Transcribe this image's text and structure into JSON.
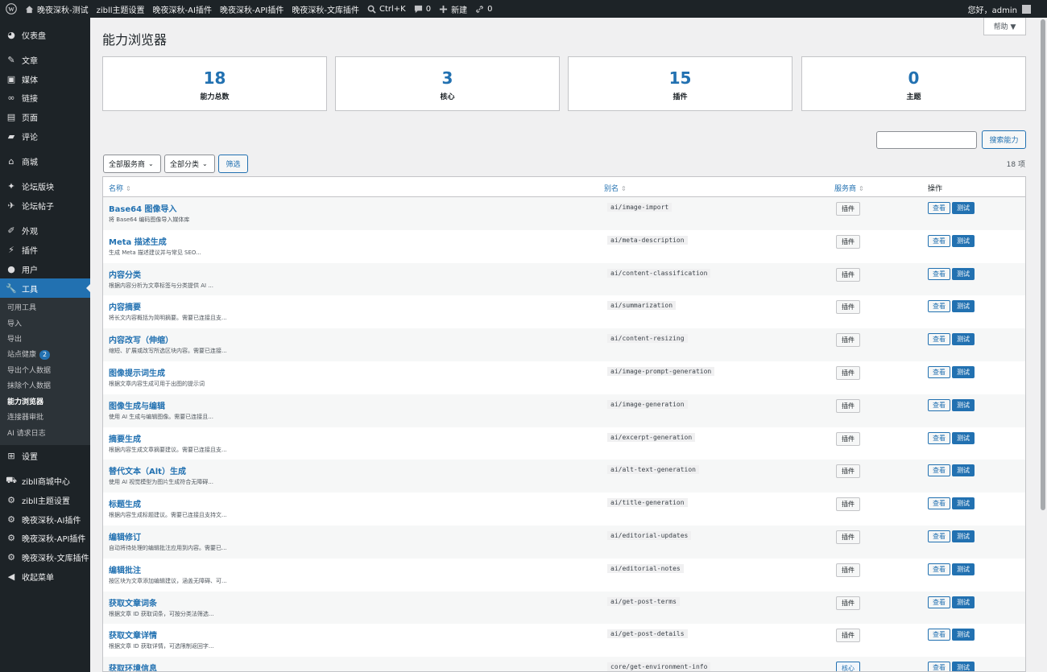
{
  "adminbar": {
    "site_name": "晚夜深秋-测试",
    "items": [
      "zibll主题设置",
      "晚夜深秋-AI插件",
      "晚夜深秋-API插件",
      "晚夜深秋-文库插件"
    ],
    "search_label": "Ctrl+K",
    "comments_count": "0",
    "new_label": "新建",
    "links_count": "0",
    "greeting": "您好，admin"
  },
  "sidebar": {
    "items": [
      {
        "label": "仪表盘",
        "icon": "dashboard-icon"
      },
      {
        "label": "文章",
        "icon": "pin-icon"
      },
      {
        "label": "媒体",
        "icon": "media-icon"
      },
      {
        "label": "链接",
        "icon": "link-icon"
      },
      {
        "label": "页面",
        "icon": "page-icon"
      },
      {
        "label": "评论",
        "icon": "comment-icon"
      },
      {
        "label": "商城",
        "icon": "store-icon"
      },
      {
        "label": "论坛版块",
        "icon": "forum-icon"
      },
      {
        "label": "论坛帖子",
        "icon": "post-icon"
      },
      {
        "label": "外观",
        "icon": "brush-icon"
      },
      {
        "label": "插件",
        "icon": "plugin-icon"
      },
      {
        "label": "用户",
        "icon": "user-icon"
      },
      {
        "label": "工具",
        "icon": "wrench-icon"
      },
      {
        "label": "设置",
        "icon": "settings-icon"
      },
      {
        "label": "zibll商城中心",
        "icon": "cart-icon"
      },
      {
        "label": "zibll主题设置",
        "icon": "gear-icon"
      },
      {
        "label": "晚夜深秋-AI插件",
        "icon": "gear-icon"
      },
      {
        "label": "晚夜深秋-API插件",
        "icon": "gear-icon"
      },
      {
        "label": "晚夜深秋-文库插件",
        "icon": "gear-icon"
      },
      {
        "label": "收起菜单",
        "icon": "collapse-icon"
      }
    ],
    "submenu": [
      "可用工具",
      "导入",
      "导出",
      "站点健康",
      "导出个人数据",
      "抹除个人数据",
      "能力浏览器",
      "连接器审批",
      "AI 请求日志"
    ],
    "health_badge": "2"
  },
  "page": {
    "title": "能力浏览器",
    "help": "帮助 ▼"
  },
  "stats": [
    {
      "value": "18",
      "label": "能力总数"
    },
    {
      "value": "3",
      "label": "核心"
    },
    {
      "value": "15",
      "label": "插件"
    },
    {
      "value": "0",
      "label": "主题"
    }
  ],
  "toolbar": {
    "search_button": "搜索能力",
    "provider_select": "全部服务商",
    "category_select": "全部分类",
    "filter_button": "筛选",
    "count": "18 项"
  },
  "table": {
    "headers": {
      "name": "名称",
      "slug": "别名",
      "provider": "服务商",
      "actions": "操作"
    },
    "view_label": "查看",
    "test_label": "测试",
    "rows": [
      {
        "title": "Base64 图像导入",
        "desc": "将 Base64 编码图像导入媒体库",
        "slug": "ai/image-import",
        "provider": "插件"
      },
      {
        "title": "Meta 描述生成",
        "desc": "生成 Meta 描述建议并与常见 SEO...",
        "slug": "ai/meta-description",
        "provider": "插件"
      },
      {
        "title": "内容分类",
        "desc": "根据内容分析为文章标签与分类提供 AI ...",
        "slug": "ai/content-classification",
        "provider": "插件"
      },
      {
        "title": "内容摘要",
        "desc": "将长文内容概括为简明摘要。需要已连接且支...",
        "slug": "ai/summarization",
        "provider": "插件"
      },
      {
        "title": "内容改写（伸缩）",
        "desc": "缩短、扩展或改写所选区块内容。需要已连接...",
        "slug": "ai/content-resizing",
        "provider": "插件"
      },
      {
        "title": "图像提示词生成",
        "desc": "根据文章内容生成可用于出图的提示词",
        "slug": "ai/image-prompt-generation",
        "provider": "插件"
      },
      {
        "title": "图像生成与编辑",
        "desc": "使用 AI 生成与编辑图像。需要已连接且...",
        "slug": "ai/image-generation",
        "provider": "插件"
      },
      {
        "title": "摘要生成",
        "desc": "根据内容生成文章摘要建议。需要已连接且支...",
        "slug": "ai/excerpt-generation",
        "provider": "插件"
      },
      {
        "title": "替代文本（Alt）生成",
        "desc": "使用 AI 视觉模型为图片生成符合无障碍...",
        "slug": "ai/alt-text-generation",
        "provider": "插件"
      },
      {
        "title": "标题生成",
        "desc": "根据内容生成标题建议。需要已连接且支持文...",
        "slug": "ai/title-generation",
        "provider": "插件"
      },
      {
        "title": "编辑修订",
        "desc": "自动将待处理的编辑批注应用到内容。需要已...",
        "slug": "ai/editorial-updates",
        "provider": "插件"
      },
      {
        "title": "编辑批注",
        "desc": "按区块为文章添加编辑建议，涵盖无障碍、可...",
        "slug": "ai/editorial-notes",
        "provider": "插件"
      },
      {
        "title": "获取文章词条",
        "desc": "根据文章 ID 获取词条，可按分类法筛选...",
        "slug": "ai/get-post-terms",
        "provider": "插件"
      },
      {
        "title": "获取文章详情",
        "desc": "根据文章 ID 获取详情，可选限制返回字...",
        "slug": "ai/get-post-details",
        "provider": "插件"
      },
      {
        "title": "获取环境信息",
        "desc": "",
        "slug": "core/get-environment-info",
        "provider": "核心"
      }
    ]
  }
}
